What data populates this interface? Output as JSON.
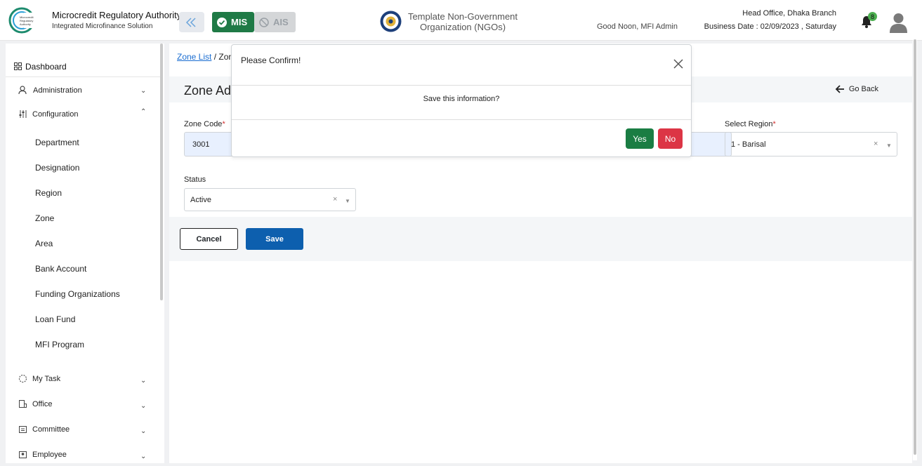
{
  "header": {
    "brand_title": "Microcredit Regulatory Authority",
    "brand_subtitle": "Integrated Microfinance Solution",
    "logo_text": "Microcredit Regulatory Authority",
    "mis_label": "MIS",
    "ais_label": "AIS",
    "org_name": "Template Non-Government Organization (NGOs)",
    "greeting": "Good Noon, MFI Admin",
    "branch": "Head Office, Dhaka Branch",
    "business_date": "Business Date : 02/09/2023 , Saturday",
    "notification_count": "8"
  },
  "sidebar": {
    "dashboard": "Dashboard",
    "administration": "Administration",
    "configuration": "Configuration",
    "config_items": [
      "Department",
      "Designation",
      "Region",
      "Zone",
      "Area",
      "Bank Account",
      "Funding Organizations",
      "Loan Fund",
      "MFI Program"
    ],
    "my_task": "My Task",
    "office": "Office",
    "committee": "Committee",
    "employee": "Employee"
  },
  "main": {
    "breadcrumb_link": "Zone List",
    "breadcrumb_sep": "/",
    "breadcrumb_current": "Zon",
    "page_title": "Zone Ad",
    "go_back": "Go Back",
    "zone_code_label": "Zone Code",
    "zone_code_value": "3001",
    "region_label": "Select Region",
    "region_value": "1 - Barisal",
    "status_label": "Status",
    "status_value": "Active",
    "required_mark": "*",
    "cancel_label": "Cancel",
    "save_label": "Save"
  },
  "modal": {
    "title": "Please Confirm!",
    "message": "Save this information?",
    "yes_label": "Yes",
    "no_label": "No"
  },
  "colors": {
    "mis_green": "#1f7a46",
    "save_blue": "#0d5fae",
    "yes_green": "#1a7d43",
    "no_red": "#dc3545",
    "link_blue": "#1a6dd1"
  }
}
